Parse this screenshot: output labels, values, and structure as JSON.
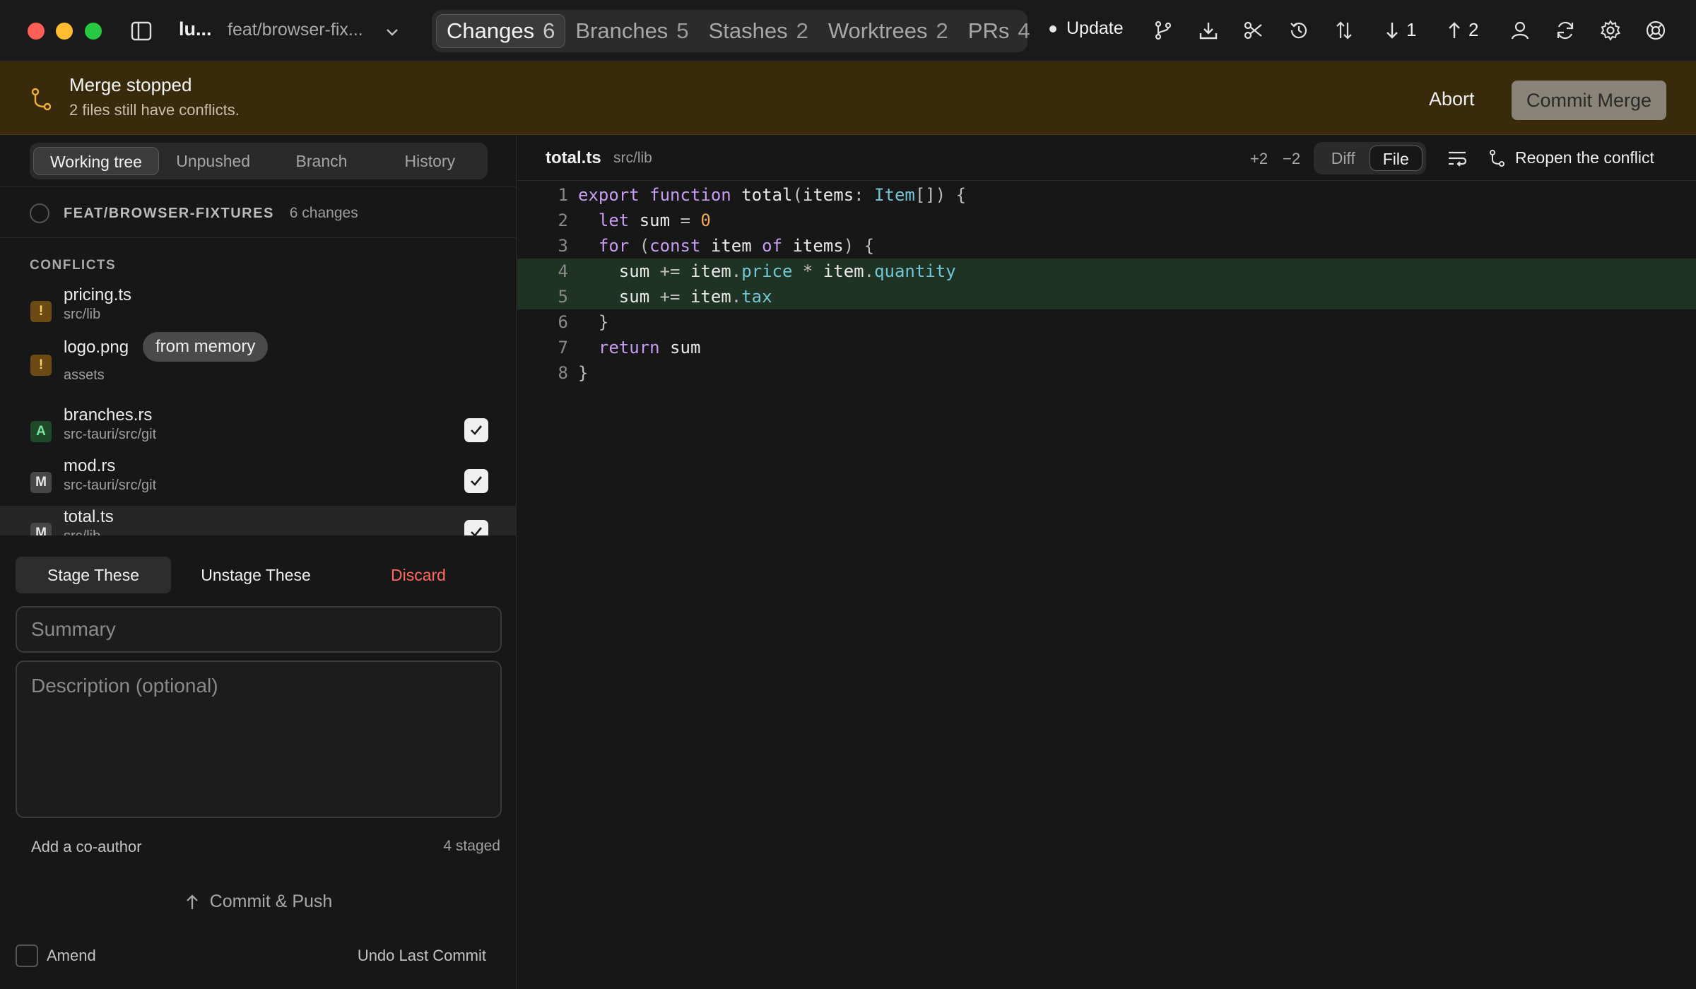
{
  "titlebar": {
    "repo": "lu...",
    "branch": "feat/browser-fix...",
    "tabs": [
      {
        "label": "Changes",
        "count": "6"
      },
      {
        "label": "Branches",
        "count": "5"
      },
      {
        "label": "Stashes",
        "count": "2"
      },
      {
        "label": "Worktrees",
        "count": "2"
      },
      {
        "label": "PRs",
        "count": "4"
      }
    ],
    "update_label": "Update",
    "behind_count": "1",
    "ahead_count": "2",
    "icons": [
      "branch-icon",
      "download-icon",
      "scissors-icon",
      "history-icon",
      "swap-icon",
      "arrow-down-icon",
      "arrow-up-icon",
      "user-icon",
      "refresh-icon",
      "gear-icon",
      "help-icon"
    ]
  },
  "banner": {
    "title": "Merge stopped",
    "subtitle": "2 files still have conflicts.",
    "abort_label": "Abort",
    "commit_merge_label": "Commit Merge"
  },
  "left": {
    "segments": [
      "Working tree",
      "Unpushed",
      "Branch",
      "History"
    ],
    "branch_title": "FEAT/BROWSER-FIXTURES",
    "branch_changes": "6 changes",
    "conflicts_label": "CONFLICTS",
    "conflict_files": [
      {
        "badge": "!",
        "name": "pricing.ts",
        "dir": "src/lib"
      },
      {
        "badge": "!",
        "name": "logo.png",
        "dir": "assets",
        "pill": "from memory"
      }
    ],
    "changed_files": [
      {
        "badge": "A",
        "name": "branches.rs",
        "dir": "src-tauri/src/git"
      },
      {
        "badge": "M",
        "name": "mod.rs",
        "dir": "src-tauri/src/git"
      },
      {
        "badge": "M",
        "name": "total.ts",
        "dir": "src/lib"
      }
    ],
    "actions": {
      "stage": "Stage These",
      "unstage": "Unstage These",
      "discard": "Discard"
    },
    "summary_placeholder": "Summary",
    "description_placeholder": "Description (optional)",
    "coauthor_label": "Add a co-author",
    "staged_label": "4 staged",
    "commit_push_label": "Commit & Push",
    "amend_label": "Amend",
    "undo_label": "Undo Last Commit"
  },
  "editor": {
    "file": "total.ts",
    "dir": "src/lib",
    "additions": "+2",
    "deletions": "−2",
    "view_options": [
      "Diff",
      "File"
    ],
    "reopen_label": "Reopen the conflict",
    "lines": [
      {
        "n": "1",
        "text": "export function total(items: Item[]) {"
      },
      {
        "n": "2",
        "text": "  let sum = 0"
      },
      {
        "n": "3",
        "text": "  for (const item of items) {"
      },
      {
        "n": "4",
        "text": "    sum += item.price * item.quantity"
      },
      {
        "n": "5",
        "text": "    sum += item.tax"
      },
      {
        "n": "6",
        "text": "  }"
      },
      {
        "n": "7",
        "text": "  return sum"
      },
      {
        "n": "8",
        "text": "}"
      }
    ]
  }
}
